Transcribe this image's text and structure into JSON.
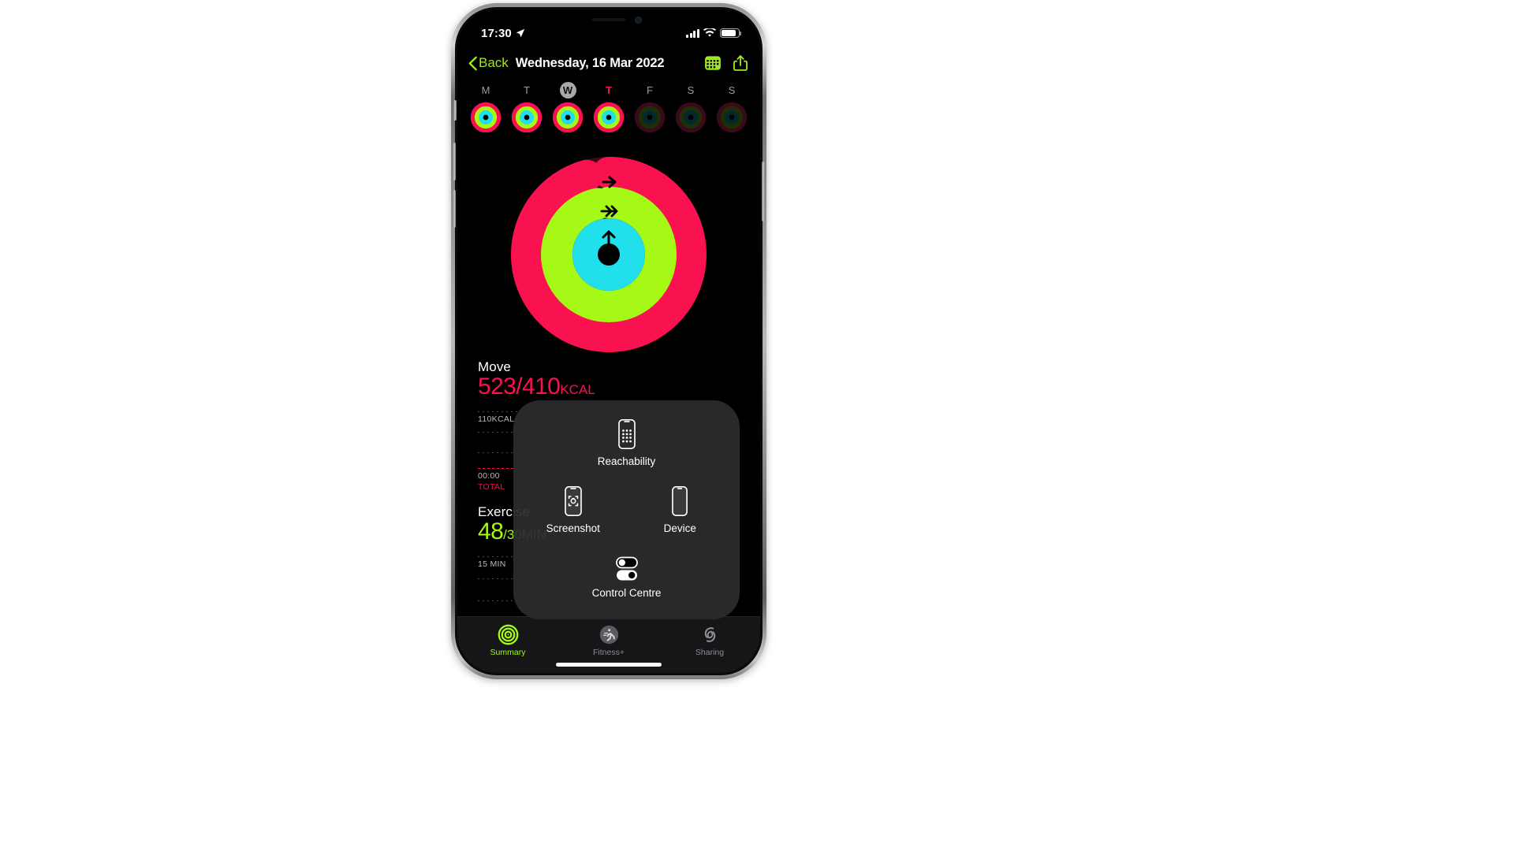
{
  "status_bar": {
    "time": "17:30",
    "location_icon": "location-arrow-icon",
    "signal_icon": "cellular-bars-icon",
    "wifi_icon": "wifi-icon",
    "battery_icon": "battery-icon"
  },
  "nav": {
    "back_label": "Back",
    "back_icon": "chevron-left-icon",
    "title": "Wednesday, 16 Mar 2022",
    "calendar_icon": "calendar-icon",
    "share_icon": "share-icon",
    "accent_color": "#9fe821"
  },
  "week": {
    "days": [
      {
        "letter": "M",
        "state": "complete"
      },
      {
        "letter": "T",
        "state": "complete"
      },
      {
        "letter": "W",
        "state": "today"
      },
      {
        "letter": "T",
        "state": "selected"
      },
      {
        "letter": "F",
        "state": "empty"
      },
      {
        "letter": "S",
        "state": "empty"
      },
      {
        "letter": "S",
        "state": "empty"
      }
    ]
  },
  "rings": {
    "move_color": "#fa114f",
    "exercise_color": "#a6f916",
    "stand_color": "#22dfec",
    "move_arrow_icon": "arrow-right-icon",
    "exercise_arrow_icon": "arrow-double-right-icon",
    "stand_arrow_icon": "arrow-up-icon"
  },
  "metrics": {
    "move": {
      "title": "Move",
      "value": "523/410",
      "unit": "KCAL",
      "graph_label": "110KCAL",
      "total_time": "00:00",
      "total_label": "TOTAL"
    },
    "exercise": {
      "title": "Exercise",
      "value": "48",
      "unit": "/30MIN",
      "graph_label": "15 MIN"
    }
  },
  "assistive_touch": {
    "items": [
      {
        "label": "Reachability",
        "icon": "phone-reachability-icon"
      },
      {
        "label": "Screenshot",
        "icon": "phone-screenshot-icon"
      },
      {
        "label": "Device",
        "icon": "phone-device-icon"
      },
      {
        "label": "Control\nCentre",
        "icon": "toggles-icon"
      }
    ]
  },
  "tabbar": {
    "tabs": [
      {
        "label": "Summary",
        "icon": "activity-rings-icon",
        "active": true
      },
      {
        "label": "Fitness+",
        "icon": "running-person-icon",
        "active": false
      },
      {
        "label": "Sharing",
        "icon": "sharing-rings-icon",
        "active": false
      }
    ]
  }
}
